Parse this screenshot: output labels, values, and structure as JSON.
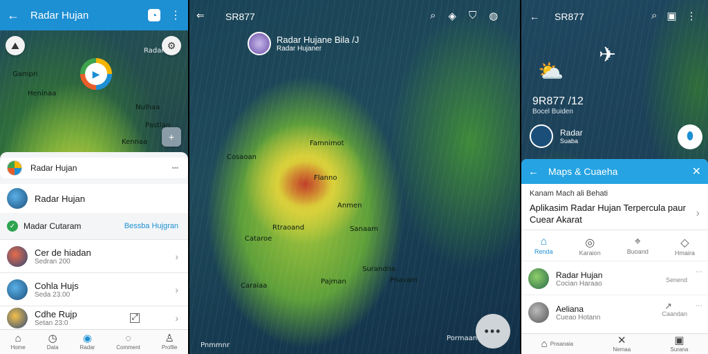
{
  "left_screen": {
    "appbar": {
      "back_icon": "arrow-left-icon",
      "title": "Radar Hujan",
      "badge_icon": "notification-icon",
      "menu_icon": "more-vert-icon"
    },
    "map_labels": [
      "Radar",
      "Gampri",
      "Heninaa",
      "Nulhaa",
      "Pastlan",
      "Kennaa"
    ],
    "sheet": {
      "search_row": {
        "label": "Radar Hujan",
        "action": "•••"
      },
      "profile_row": {
        "label": "Radar Hujan"
      },
      "status_row": {
        "label": "Madar Cutaram",
        "link": "Bessba Hujgran"
      },
      "items": [
        {
          "title": "Cer de hiadan",
          "subtitle": "Sedran 200"
        },
        {
          "title": "Cohla Hujs",
          "subtitle": "Seda 23.00"
        },
        {
          "title": "Cdhe Rujp",
          "subtitle": "Setan 23:0"
        }
      ]
    },
    "bottom_nav": [
      {
        "icon": "home-icon",
        "label": "Home"
      },
      {
        "icon": "clock-icon",
        "label": "Data"
      },
      {
        "icon": "radar-icon",
        "label": "Radar"
      },
      {
        "icon": "chat-icon",
        "label": "Comment"
      },
      {
        "icon": "person-icon",
        "label": "Profile"
      }
    ]
  },
  "center_screen": {
    "title": "SR877",
    "header_card": {
      "title": "Radar Hujane Bila /J",
      "subtitle": "Radar Hujaner"
    },
    "map_labels": [
      "Famnimot",
      "Cosaoan",
      "Flanno",
      "Anmen",
      "Rtraoand",
      "Sanaam",
      "Cataroe",
      "Surandna",
      "Pajman",
      "Pnavam",
      "Caraiaa",
      "Pormaan",
      "Pnmmnr"
    ],
    "fab_label": "•••"
  },
  "right_screen": {
    "title": "SR877",
    "weather": {
      "value": "9R877 /12",
      "subtitle": "Bocel Buiden"
    },
    "station": {
      "title": "Radar",
      "subtitle": "Suaba"
    },
    "sheet": {
      "bar_title": "Maps & Cuaeha",
      "caption": "Kanam Mach ali Behati",
      "headline": "Aplikasim Radar Hujan Terpercula paur Cuear Akarat",
      "tabs": [
        {
          "icon": "home-icon",
          "label": "Renda",
          "active": true
        },
        {
          "icon": "radar-icon",
          "label": "Karaion"
        },
        {
          "icon": "location-icon",
          "label": "Buoand"
        },
        {
          "icon": "tag-icon",
          "label": "Hmaira"
        }
      ],
      "items": [
        {
          "title": "Radar Hujan",
          "subtitle": "Cocian Haraao",
          "meta": "Senend"
        },
        {
          "title": "Aeliana",
          "subtitle": "Cueao Hotann",
          "meta": "Caandan"
        }
      ]
    },
    "bottom_nav": [
      {
        "icon": "home-icon",
        "label": "Pnsanaia"
      },
      {
        "icon": "close-icon",
        "label": "Nemaa"
      },
      {
        "icon": "box-icon",
        "label": "Surana"
      }
    ]
  }
}
